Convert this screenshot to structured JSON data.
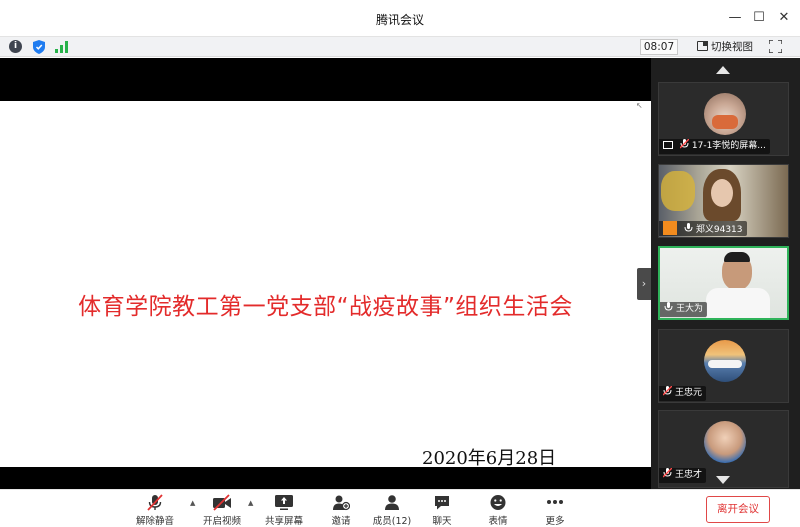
{
  "window": {
    "title": "腾讯会议",
    "controls": {
      "minimize": "—",
      "maximize": "☐",
      "close": "✕"
    }
  },
  "infobar": {
    "timer": "08:07",
    "switch_view_label": "切换视图",
    "icons": [
      "info-icon",
      "shield-icon",
      "signal-icon",
      "fullscreen-icon"
    ]
  },
  "shared_screen": {
    "title": "体育学院教工第一党支部“战疫故事”组织生活会",
    "date": "2020年6月28日",
    "annotation_tools": "✎ ∿ ◆ ⌫ ↖ ◎",
    "title_color": "#e32b2b"
  },
  "participants": [
    {
      "name": "17-1李悦的屏幕...",
      "type": "screen-share",
      "mic": "muted"
    },
    {
      "name": "郑义94313",
      "type": "video",
      "mic": "on"
    },
    {
      "name": "王大为",
      "type": "video",
      "mic": "on",
      "active": true
    },
    {
      "name": "王忠元",
      "type": "avatar",
      "mic": "muted"
    },
    {
      "name": "王忠才",
      "type": "avatar",
      "mic": "muted"
    }
  ],
  "toolbar": {
    "unmute": "解除静音",
    "start_video": "开启视频",
    "share_screen": "共享屏幕",
    "invite": "邀请",
    "members": "成员(12)",
    "chat": "聊天",
    "reactions": "表情",
    "more": "更多",
    "leave": "离开会议"
  },
  "colors": {
    "accent_red": "#e03232",
    "active_border": "#2fb35a",
    "sidebar_bg": "#1f1f1f"
  }
}
